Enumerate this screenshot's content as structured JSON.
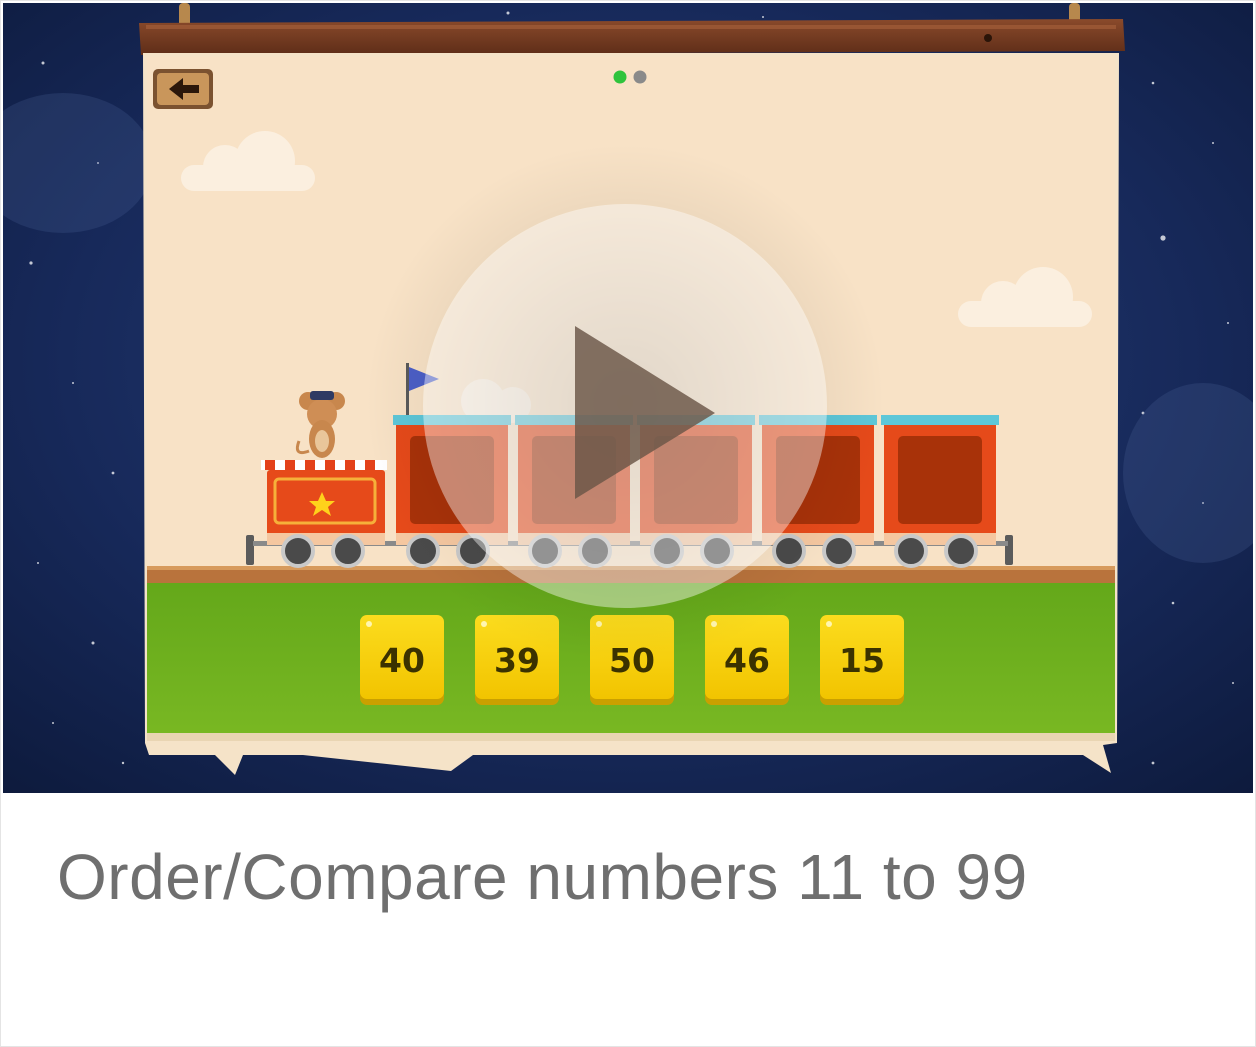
{
  "lesson": {
    "title": "Order/Compare numbers 11 to 99"
  },
  "game": {
    "page_indicator": {
      "count": 2,
      "active_index": 0
    },
    "number_tiles": [
      "40",
      "39",
      "50",
      "46",
      "15"
    ]
  },
  "icons": {
    "back": "arrow-left-icon",
    "play": "play-icon"
  },
  "colors": {
    "night_sky": "#15264f",
    "sign_board": "#f6e1c4",
    "grass": "#6fb01f",
    "wagon": "#e0521d",
    "tile": "#f6cf0a",
    "dot_active": "#2fc33c",
    "dot_inactive": "#8a8a8a",
    "caption_text": "#6f6f6f"
  }
}
